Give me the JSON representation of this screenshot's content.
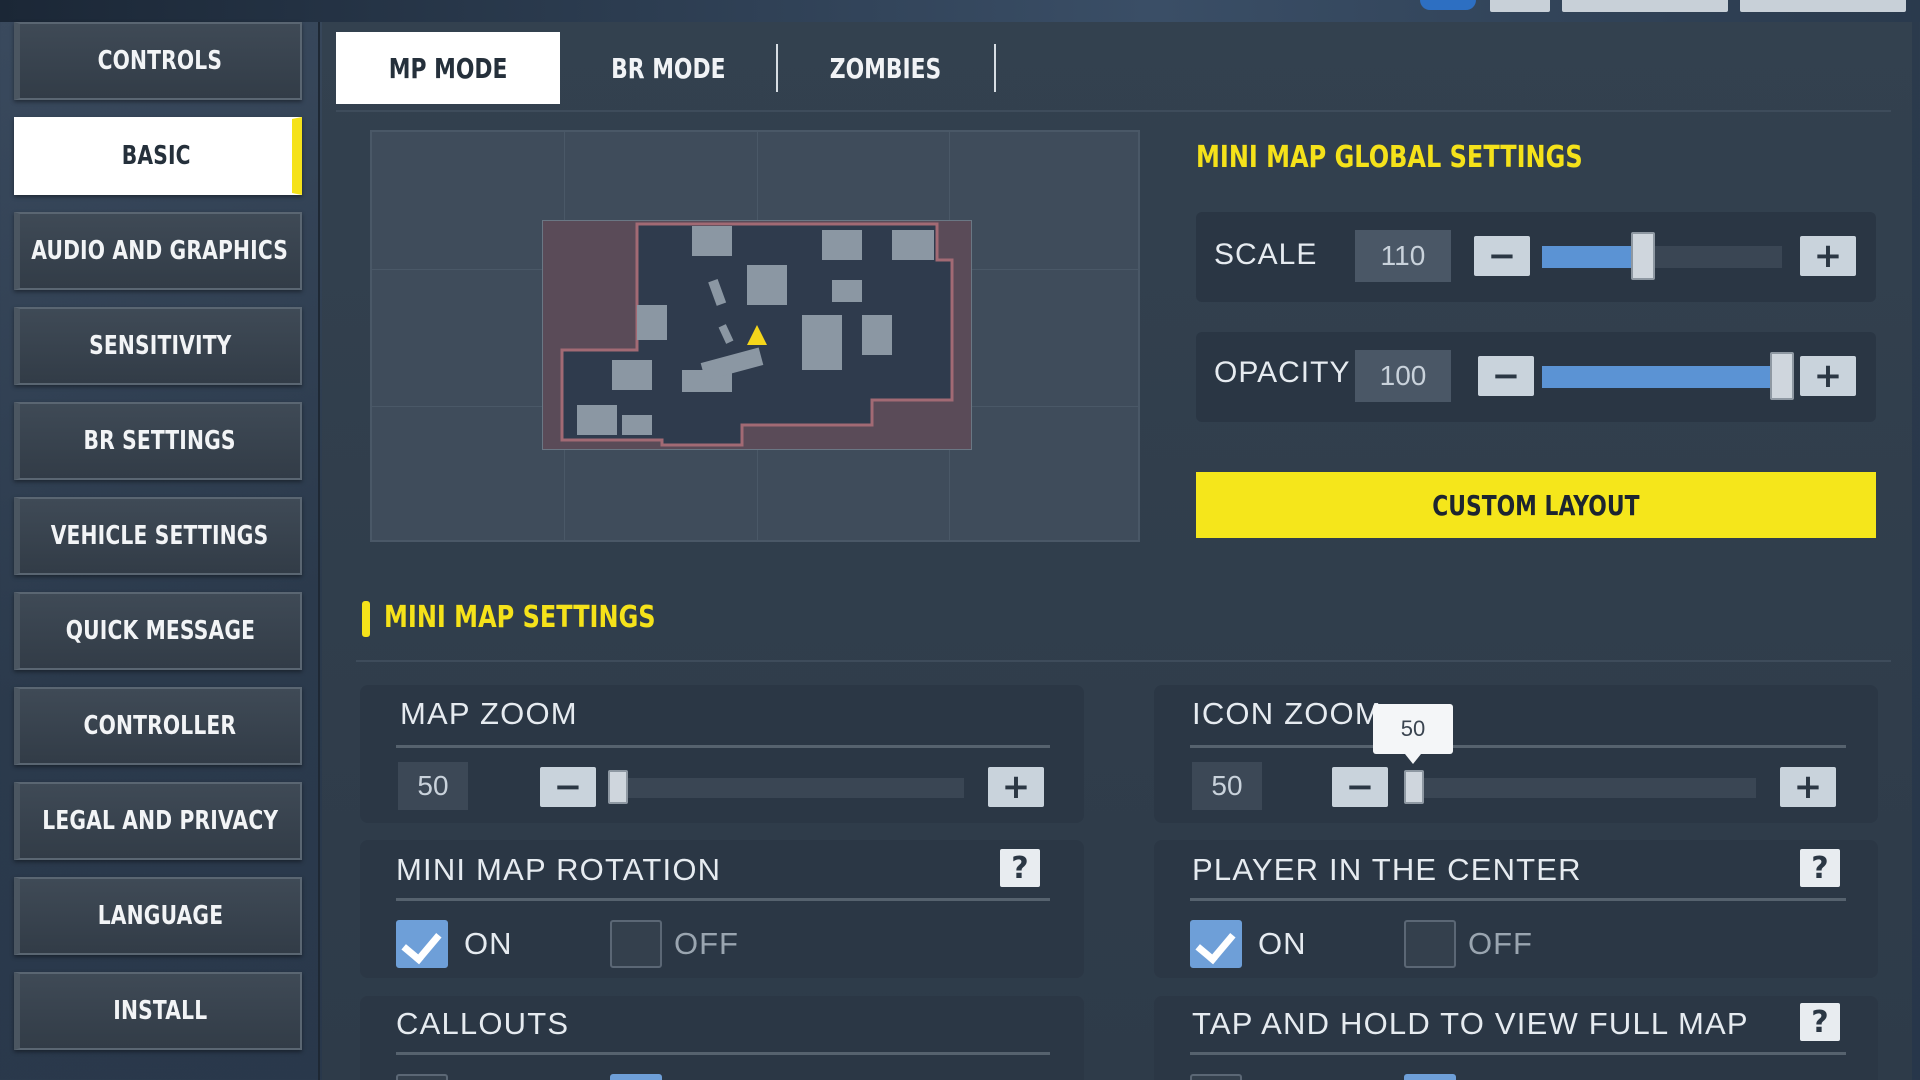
{
  "sidebar": {
    "items": [
      {
        "label": "CONTROLS",
        "active": false
      },
      {
        "label": "BASIC",
        "active": true
      },
      {
        "label": "AUDIO AND GRAPHICS",
        "active": false
      },
      {
        "label": "SENSITIVITY",
        "active": false
      },
      {
        "label": "BR SETTINGS",
        "active": false
      },
      {
        "label": "VEHICLE SETTINGS",
        "active": false
      },
      {
        "label": "QUICK MESSAGE",
        "active": false
      },
      {
        "label": "CONTROLLER",
        "active": false
      },
      {
        "label": "LEGAL AND PRIVACY",
        "active": false
      },
      {
        "label": "LANGUAGE",
        "active": false
      },
      {
        "label": "INSTALL",
        "active": false
      }
    ]
  },
  "tabs": [
    {
      "label": "MP MODE",
      "active": true
    },
    {
      "label": "BR MODE",
      "active": false
    },
    {
      "label": "ZOMBIES",
      "active": false
    }
  ],
  "global_settings": {
    "title": "MINI MAP GLOBAL SETTINGS",
    "scale": {
      "label": "SCALE",
      "value": "110",
      "fraction": 0.42
    },
    "opacity": {
      "label": "OPACITY",
      "value": "100",
      "fraction": 1.0
    },
    "custom_layout_label": "CUSTOM LAYOUT"
  },
  "minimap_settings": {
    "title": "MINI MAP SETTINGS",
    "map_zoom": {
      "label": "MAP ZOOM",
      "value": "50",
      "fraction": 0.0
    },
    "icon_zoom": {
      "label": "ICON ZOOM",
      "value": "50",
      "fraction": 0.0,
      "tooltip": "50"
    },
    "rotation": {
      "label": "MINI MAP ROTATION",
      "on_label": "ON",
      "off_label": "OFF",
      "selected": "on",
      "help": "?"
    },
    "player_center": {
      "label": "PLAYER IN THE CENTER",
      "on_label": "ON",
      "off_label": "OFF",
      "selected": "on",
      "help": "?"
    },
    "callouts": {
      "label": "CALLOUTS"
    },
    "tap_hold": {
      "label": "TAP AND HOLD TO VIEW FULL MAP",
      "help": "?"
    }
  },
  "icons": {
    "minus": "−",
    "plus": "+"
  },
  "colors": {
    "accent_yellow": "#f5e21a",
    "slider_fill": "#5b93d4",
    "checkbox_on": "#6e9fd8"
  }
}
